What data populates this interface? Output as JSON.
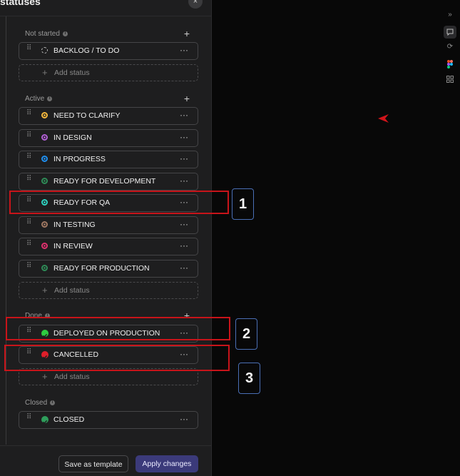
{
  "panel": {
    "title": "statuses",
    "close_glyph": "×"
  },
  "groups": [
    {
      "label": "Not started",
      "statuses": [
        {
          "name": "BACKLOG / TO DO",
          "color": "#bdbdbd",
          "dot_style": "dashed"
        }
      ],
      "add_label": "Add status"
    },
    {
      "label": "Active",
      "statuses": [
        {
          "name": "NEED TO CLARIFY",
          "color": "#f5b83d"
        },
        {
          "name": "IN DESIGN",
          "color": "#b25fd6"
        },
        {
          "name": "IN PROGRESS",
          "color": "#1f8ff0"
        },
        {
          "name": "READY FOR DEVELOPMENT",
          "color": "#2e8b57"
        },
        {
          "name": "READY FOR QA",
          "color": "#2ed3c1"
        },
        {
          "name": "IN TESTING",
          "color": "#a07862"
        },
        {
          "name": "IN REVIEW",
          "color": "#e0316e"
        },
        {
          "name": "READY FOR PRODUCTION",
          "color": "#2e8b57"
        }
      ],
      "add_label": "Add status"
    },
    {
      "label": "Done",
      "statuses": [
        {
          "name": "DEPLOYED ON PRODUCTION",
          "color": "#2ecc40",
          "icon": "check-icon"
        },
        {
          "name": "CANCELLED",
          "color": "#e01e2a",
          "icon": "check-icon"
        }
      ],
      "add_label": "Add status"
    },
    {
      "label": "Closed",
      "statuses": [
        {
          "name": "CLOSED",
          "color": "#2e9e5b",
          "icon": "check-icon"
        }
      ]
    }
  ],
  "footer": {
    "save_template_label": "Save as template",
    "apply_label": "Apply changes"
  },
  "annotations": [
    "1",
    "2",
    "3"
  ],
  "row_menu_glyph": "···",
  "info_glyph": "i",
  "plus_glyph": "+",
  "drag_glyph": "⠿",
  "colors": {
    "highlight": "#c8141a",
    "badge_border": "#4a6fb5",
    "apply_button": "#3b3a7a",
    "cursor": "#d0141a"
  },
  "right_rail_icons": [
    "expand-icon",
    "chat-icon",
    "link-icon",
    "figma-icon",
    "apps-icon"
  ]
}
